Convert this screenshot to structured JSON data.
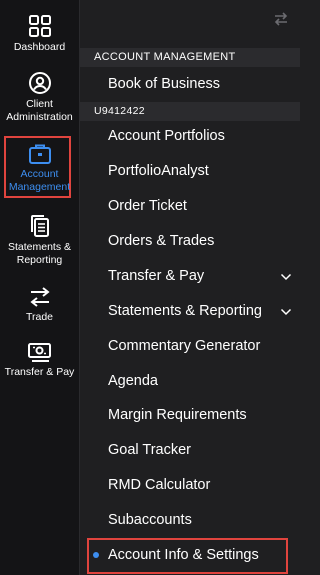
{
  "rail": {
    "items": [
      {
        "label": "Dashboard",
        "icon": "dashboard-grid-icon"
      },
      {
        "label": "Client Administration",
        "icon": "user-circle-icon"
      },
      {
        "label": "Account Management",
        "icon": "briefcase-icon",
        "active": true
      },
      {
        "label": "Statements & Reporting",
        "icon": "documents-icon"
      },
      {
        "label": "Trade",
        "icon": "swap-arrows-icon"
      },
      {
        "label": "Transfer & Pay",
        "icon": "money-transfer-icon"
      }
    ]
  },
  "panel": {
    "header_icon": "swap-icon",
    "section_title": "ACCOUNT MANAGEMENT",
    "first_item": "Book of Business",
    "account_id": "U9412422",
    "items": [
      {
        "label": "Account Portfolios"
      },
      {
        "label": "PortfolioAnalyst"
      },
      {
        "label": "Order Ticket"
      },
      {
        "label": "Orders & Trades"
      },
      {
        "label": "Transfer & Pay",
        "expandable": true
      },
      {
        "label": "Statements & Reporting",
        "expandable": true
      },
      {
        "label": "Commentary Generator"
      },
      {
        "label": "Agenda"
      },
      {
        "label": "Margin Requirements"
      },
      {
        "label": "Goal Tracker"
      },
      {
        "label": "RMD Calculator"
      },
      {
        "label": "Subaccounts"
      },
      {
        "label": "Account Info & Settings",
        "selected": true
      }
    ]
  },
  "colors": {
    "accent": "#3d8ef0",
    "highlight_border": "#e0443e",
    "rail_bg": "#141416",
    "panel_bg": "#1f1f21",
    "section_bg": "#2b2b2e"
  }
}
